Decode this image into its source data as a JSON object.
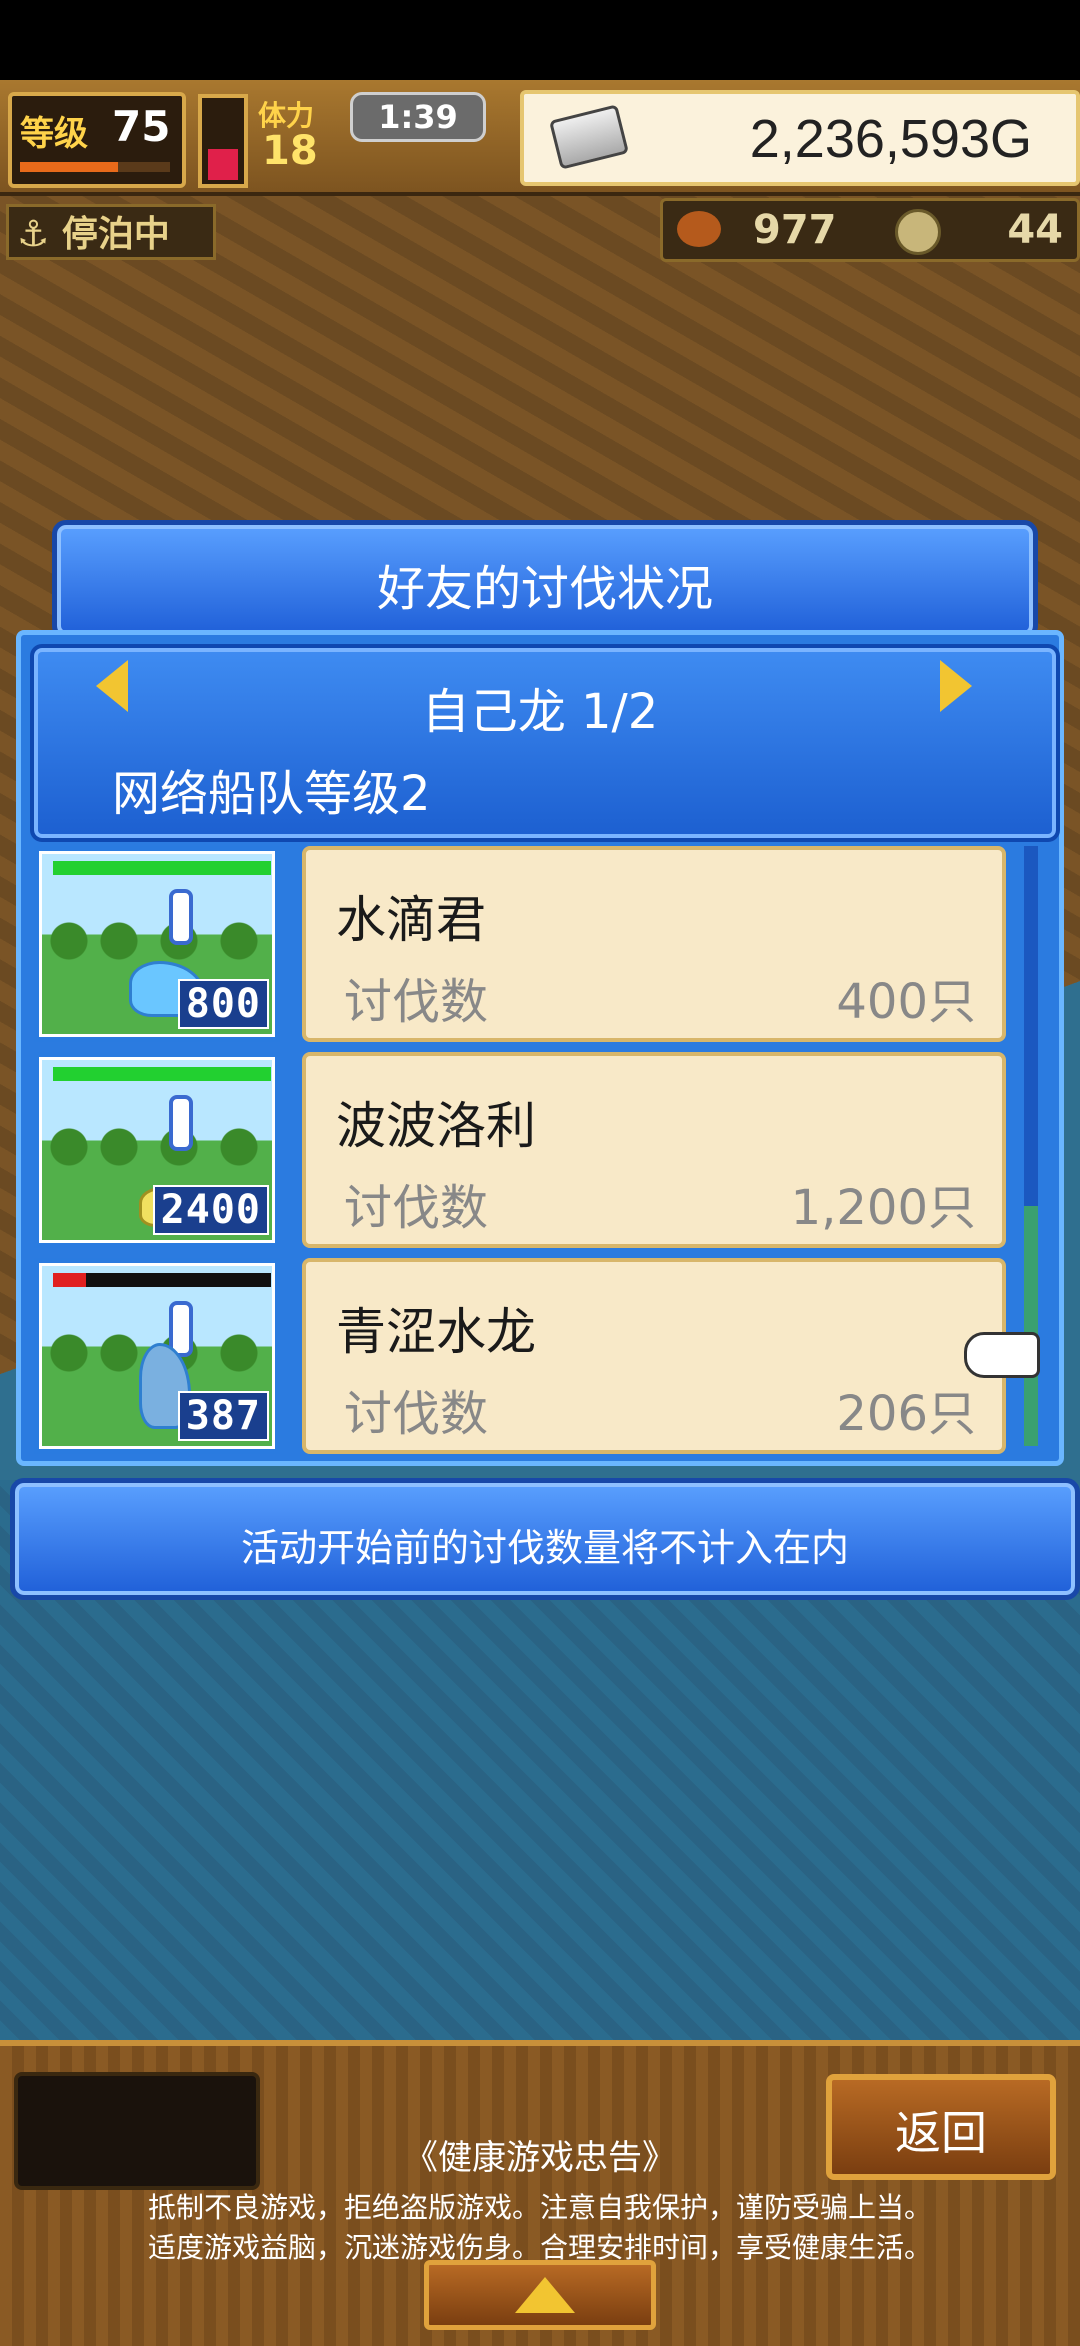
{
  "hud": {
    "level_label": "等级",
    "level_value": "75",
    "level_progress": 0.65,
    "stamina_label": "体力",
    "stamina_value": "18",
    "stamina_fill": 0.4,
    "timer": "1:39",
    "gold": "2,236,593G",
    "anchor_status": "停泊中",
    "food": "977",
    "coins": "44"
  },
  "dialog": {
    "title": "好友的讨伐状况",
    "dragon_page": "自己龙 1/2",
    "fleet_level": "网络船队等级2",
    "kill_label": "讨伐数",
    "notice": "活动开始前的讨伐数量将不计入在内"
  },
  "monsters": [
    {
      "name": "水滴君",
      "thumb_num": "800",
      "hp": 1.0,
      "kills": "400只"
    },
    {
      "name": "波波洛利",
      "thumb_num": "2400",
      "hp": 1.0,
      "kills": "1,200只"
    },
    {
      "name": "青涩水龙",
      "thumb_num": "387",
      "hp": 0.15,
      "kills": "206只"
    }
  ],
  "footer": {
    "back_label": "返回",
    "health_title": "《健康游戏忠告》",
    "health_line1": "抵制不良游戏，拒绝盗版游戏。注意自我保护，谨防受骗上当。",
    "health_line2": "适度游戏益脑，沉迷游戏伤身。合理安排时间，享受健康生活。"
  },
  "icons": [
    "anchor-icon",
    "silver-bar-icon",
    "food-icon",
    "coin-icon",
    "arrow-left-icon",
    "arrow-right-icon",
    "hand-pointer-icon",
    "arrow-up-icon"
  ]
}
